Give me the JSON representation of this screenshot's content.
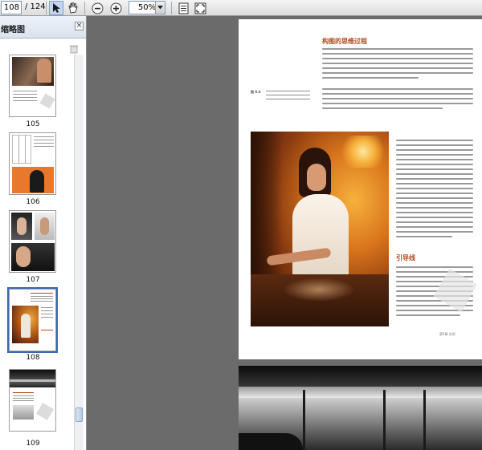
{
  "toolbar": {
    "current_page": "108",
    "page_total": "/ 124",
    "zoom": "50%",
    "icons": [
      "select-arrow-icon",
      "hand-icon",
      "zoom-out-icon",
      "zoom-in-icon",
      "fit-page-icon",
      "full-screen-icon"
    ]
  },
  "panel": {
    "title": "缩略图",
    "close_glyph": "×",
    "thumbnails": [
      {
        "label": "105"
      },
      {
        "label": "106"
      },
      {
        "label": "107"
      },
      {
        "label": "108",
        "selected": true
      },
      {
        "label": "109"
      }
    ]
  },
  "page": {
    "heading1": "构图的思维过程",
    "caption_label": "图 8.6",
    "heading2": "引导线",
    "footer": "第5章 实用"
  },
  "colors": {
    "heading": "#b5491b",
    "viewer_bg": "#6b6b6b",
    "selection": "#3b66b4"
  }
}
